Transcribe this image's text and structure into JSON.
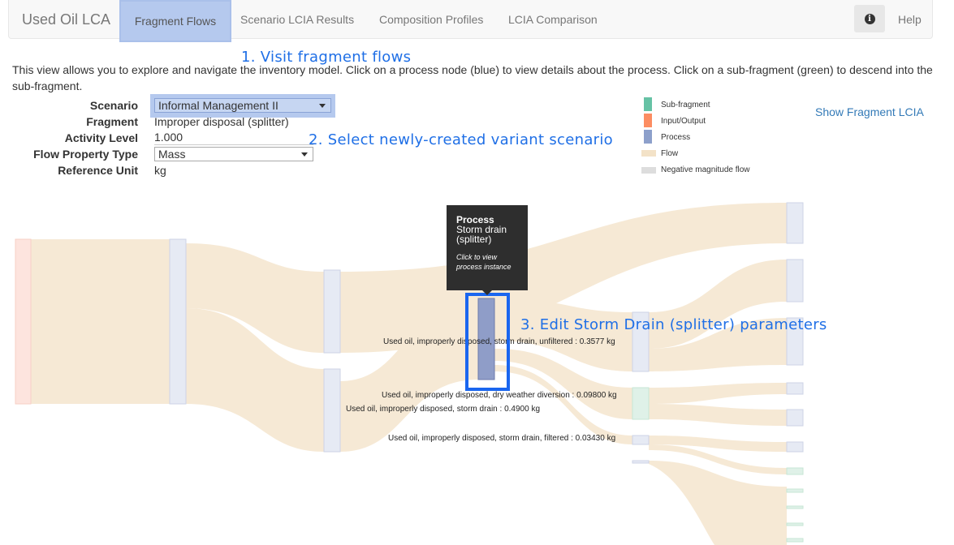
{
  "navbar": {
    "brand": "Used Oil LCA",
    "tabs": [
      {
        "label": "Fragment Flows",
        "active": true
      },
      {
        "label": "Scenario LCIA Results"
      },
      {
        "label": "Composition Profiles"
      },
      {
        "label": "LCIA Comparison"
      }
    ],
    "info_icon": "info-circle-icon",
    "help_label": "Help"
  },
  "annotations": {
    "step1": "1. Visit fragment flows",
    "step2": "2. Select newly-created variant scenario",
    "step3": "3. Edit Storm Drain (splitter) parameters"
  },
  "intro_text": "This view allows you to explore and navigate the inventory model. Click on a process node (blue) to view details about the process. Click on a sub-fragment (green) to descend into the sub-fragment.",
  "form": {
    "scenario": {
      "label": "Scenario",
      "value": "Informal Management II"
    },
    "fragment": {
      "label": "Fragment",
      "value": "Improper disposal (splitter)"
    },
    "activity_level": {
      "label": "Activity Level",
      "value": "1.000"
    },
    "flow_property_type": {
      "label": "Flow Property Type",
      "value": "Mass"
    },
    "reference_unit": {
      "label": "Reference Unit",
      "value": "kg"
    }
  },
  "legend": {
    "items": [
      {
        "label": "Sub-fragment",
        "color": "#66c2a5"
      },
      {
        "label": "Input/Output",
        "color": "#fc8d62"
      },
      {
        "label": "Process",
        "color": "#8da0cb"
      },
      {
        "label": "Flow",
        "color": "#f3e2c7"
      },
      {
        "label": "Negative magnitude flow",
        "color": "#dddddd"
      }
    ]
  },
  "show_fragment_lcia": "Show Fragment LCIA",
  "colors": {
    "flow": "#f3e2c7",
    "process_node": "#e6eaf4",
    "subfragment_node": "#dff1e8",
    "io_node": "#fde4de",
    "selected_process": "#8f9dc8",
    "accent": "#1a66ef"
  },
  "flow_labels": [
    "Used oil, improperly disposed, storm drain, unfiltered : 0.3577 kg",
    "Used oil, improperly disposed, dry weather diversion : 0.09800 kg",
    "Used oil, improperly disposed, storm drain : 0.4900 kg",
    "Used oil, improperly disposed, storm drain, filtered : 0.03430 kg"
  ],
  "tooltip": {
    "title": "Process",
    "name": "Storm drain (splitter)",
    "hint": "Click to view process instance"
  }
}
